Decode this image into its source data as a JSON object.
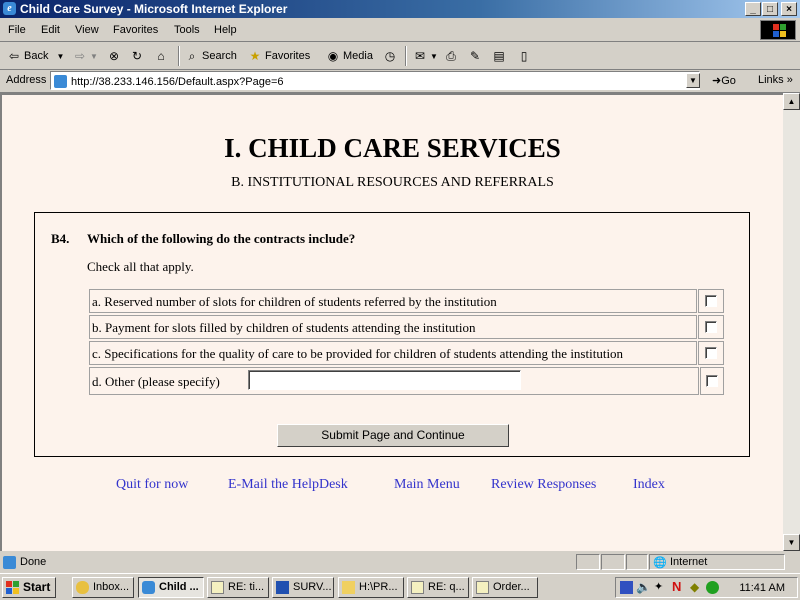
{
  "window": {
    "title": "Child Care Survey - Microsoft Internet Explorer"
  },
  "menubar": {
    "items": [
      "File",
      "Edit",
      "View",
      "Favorites",
      "Tools",
      "Help"
    ]
  },
  "toolbar": {
    "back": "Back",
    "search": "Search",
    "favorites": "Favorites",
    "media": "Media"
  },
  "address": {
    "label": "Address",
    "url": "http://38.233.146.156/Default.aspx?Page=6",
    "go": "Go",
    "links": "Links"
  },
  "page": {
    "title": "I. CHILD CARE SERVICES",
    "subtitle": "B. INSTITUTIONAL RESOURCES AND REFERRALS",
    "question": {
      "number": "B4.",
      "text": "Which of the following do the contracts include?",
      "instruction": "Check all that apply.",
      "options": [
        "a. Reserved number of slots for children of students referred by the institution",
        "b. Payment for slots filled by children of students attending the institution",
        "c. Specifications for the quality of care to be provided for children of students attending the institution",
        "d. Other (please specify)"
      ],
      "other_value": ""
    },
    "submit": "Submit Page and Continue",
    "nav_links": [
      "Quit for now",
      "E-Mail the HelpDesk",
      "Main Menu",
      "Review Responses",
      "Index"
    ]
  },
  "statusbar": {
    "status": "Done",
    "zone": "Internet"
  },
  "taskbar": {
    "start": "Start",
    "tasks": [
      "Inbox...",
      "Child ...",
      "RE: ti...",
      "SURV...",
      "H:\\PR...",
      "RE: q...",
      "Order..."
    ],
    "clock": "11:41 AM"
  },
  "colors": {
    "link": "#3333cc",
    "page_bg": "#fdf3ec",
    "titlebar": "#0a246a"
  }
}
